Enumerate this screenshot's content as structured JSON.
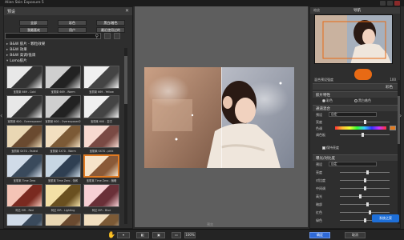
{
  "window": {
    "title": "Alien Skin Exposure 5"
  },
  "left_panel": {
    "header": "预设",
    "close": "✕",
    "tabs": [
      "全部",
      "彩色",
      "黑白/着色",
      "我最喜欢",
      "用户",
      "最近使用过的"
    ],
    "tree": [
      {
        "arrow": "▸",
        "label": "B&W 胶片 - 颗粒效果"
      },
      {
        "arrow": "▸",
        "label": "B&W 效果"
      },
      {
        "arrow": "▸",
        "label": "B&W 高调/低调"
      },
      {
        "arrow": "▾",
        "label": "Lomo胶片"
      }
    ],
    "thumbnails": [
      {
        "caption": "宝丽莱 669 - Cold",
        "tone": "bw"
      },
      {
        "caption": "宝丽莱 669 - Warm",
        "tone": "bw2"
      },
      {
        "caption": "宝丽莱 669 - Yellow",
        "tone": "bw3"
      },
      {
        "caption": "宝丽莱 600 - Overexposed",
        "tone": "bw"
      },
      {
        "caption": "宝丽莱 600 - Overexposed2",
        "tone": "bw2"
      },
      {
        "caption": "宝丽莱 600 - 复古",
        "tone": "bw3"
      },
      {
        "caption": "宝丽莱 SX70 - Faded",
        "tone": "warm"
      },
      {
        "caption": "宝丽莱 SX70 - Warm",
        "tone": "warm2"
      },
      {
        "caption": "宝丽莱 SX70 - pink",
        "tone": "warm3"
      },
      {
        "caption": "宝丽莱 Time Zero",
        "tone": "cool"
      },
      {
        "caption": "宝丽莱 Time Zero - 饱和",
        "tone": "cool2"
      },
      {
        "caption": "宝丽莱 Time Zero - 偏暖",
        "tone": "sel",
        "selected": true
      },
      {
        "caption": "柯达 EIR - Red",
        "tone": "red"
      },
      {
        "caption": "柯达 EIR - Lighting",
        "tone": "gold"
      },
      {
        "caption": "柯达 EIR - Blue",
        "tone": "pink"
      },
      {
        "caption": "柯达 Ektar - Cool",
        "tone": "cool"
      },
      {
        "caption": "柯达 Ektar - Warm",
        "tone": "warm"
      },
      {
        "caption": "柯达 Ektar - Faded",
        "tone": "warm2"
      }
    ]
  },
  "image_caption": "预览",
  "right_panel": {
    "tabs_left": "缩放",
    "navigator": "导航",
    "preset_strength_label": "混合预设强度",
    "preset_strength_value": "100",
    "sections": [
      {
        "label": "彩色",
        "align": "right"
      },
      {
        "label": "胶片特性"
      },
      {
        "label": "通道混合"
      },
      {
        "label": "曝光/对比度"
      }
    ],
    "film_type": {
      "color": "彩色",
      "bw": "黑白着色"
    },
    "channel_label": "预设",
    "channel_value": "自定",
    "rows_a": [
      {
        "label": "亮度",
        "knob": 0.5
      },
      {
        "label": "色调",
        "knob": 0.0
      },
      {
        "label": "调色板",
        "knob": 0.45
      }
    ],
    "rows_a_extra": "保持亮度",
    "rows_b_dropdown": "自定",
    "rows_b": [
      {
        "label": "亮度",
        "knob": 0.55
      },
      {
        "label": "对比度",
        "knob": 0.5
      },
      {
        "label": "中间调",
        "knob": 0.5
      },
      {
        "label": "高光",
        "knob": 0.4
      },
      {
        "label": "暗部",
        "knob": 0.55
      },
      {
        "label": "红色",
        "knob": 0.6
      },
      {
        "label": "绿色",
        "knob": 0.5
      }
    ]
  },
  "bottom_bar": {
    "zoom_value": "100%",
    "apply": "确定",
    "cancel": "取消"
  },
  "logo_text": "系统之家"
}
